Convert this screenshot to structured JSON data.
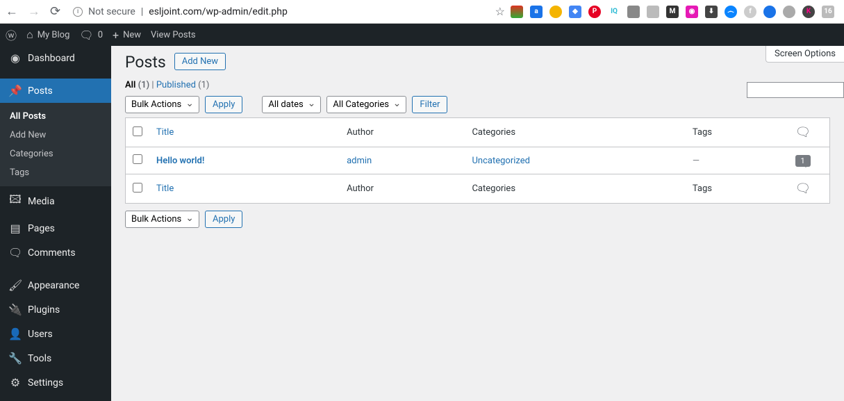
{
  "browser": {
    "not_secure": "Not secure",
    "url": "esljoint.com/wp-admin/edit.php"
  },
  "topbar": {
    "site_name": "My Blog",
    "comments_count": "0",
    "new_label": "New",
    "view_label": "View Posts"
  },
  "sidebar": {
    "dashboard": "Dashboard",
    "posts": "Posts",
    "posts_sub": {
      "all": "All Posts",
      "add": "Add New",
      "cats": "Categories",
      "tags": "Tags"
    },
    "media": "Media",
    "pages": "Pages",
    "comments": "Comments",
    "appearance": "Appearance",
    "plugins": "Plugins",
    "users": "Users",
    "tools": "Tools",
    "settings": "Settings"
  },
  "screen_options": "Screen Options",
  "page": {
    "heading": "Posts",
    "add_new": "Add New"
  },
  "filters": {
    "all_label": "All",
    "all_count": "(1)",
    "sep": " | ",
    "published_label": "Published",
    "published_count": "(1)"
  },
  "bulk": {
    "label": "Bulk Actions",
    "apply": "Apply",
    "dates": "All dates",
    "cats": "All Categories",
    "filter": "Filter"
  },
  "columns": {
    "title": "Title",
    "author": "Author",
    "categories": "Categories",
    "tags": "Tags"
  },
  "rows": [
    {
      "title": "Hello world!",
      "author": "admin",
      "category": "Uncategorized",
      "tags": "—",
      "comments": "1"
    }
  ]
}
